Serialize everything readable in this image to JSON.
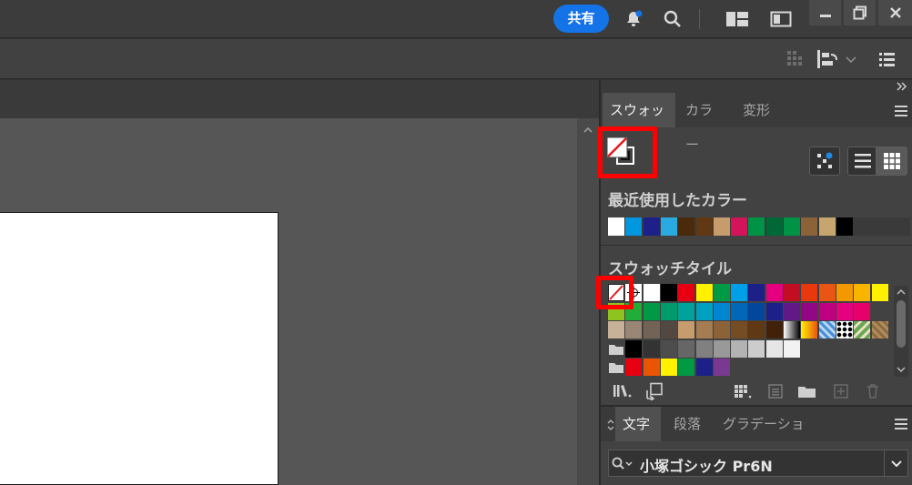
{
  "titlebar": {
    "share_label": "共有",
    "icons": [
      "bell-icon",
      "search-icon",
      "workspace-icon",
      "panel-icon",
      "minimize-icon",
      "restore-icon",
      "close-icon"
    ]
  },
  "toolbar": {
    "icons": [
      "grid-dots-icon",
      "align-icon",
      "chevron-down-icon",
      "list-icon"
    ]
  },
  "swatch_panel": {
    "tabs": [
      "スウォッチ",
      "カラー",
      "変形"
    ],
    "active_tab": "スウォッチ",
    "recent_label": "最近使用したカラー",
    "recent_colors": [
      "#ffffff",
      "#0096e0",
      "#1d2088",
      "#29abe2",
      "#4a2a0a",
      "#603813",
      "#c69c6d",
      "#d4145a",
      "#009245",
      "#006837",
      "#009245",
      "#8c6239",
      "#c7a56e",
      "#000000"
    ],
    "tiles_label": "スウォッチタイル",
    "tile_rows": [
      [
        "none",
        "registration",
        "#ffffff",
        "#000000",
        "#e60012",
        "#fff100",
        "#009944",
        "#00a0e9",
        "#1d2088",
        "#e4007f",
        "#c30d23",
        "#e8380d",
        "#e95513",
        "#f39800",
        "#f8b500",
        "#fff100"
      ],
      [
        "#8fc31f",
        "#22ac38",
        "#009944",
        "#009b6b",
        "#00a29a",
        "#00a0c1",
        "#0086d1",
        "#0068b7",
        "#00479d",
        "#1d2088",
        "#601986",
        "#920783",
        "#be0081",
        "#e4007f",
        "#e5006a"
      ],
      [
        "#c7b299",
        "#998675",
        "#736357",
        "#534741",
        "#c69c6d",
        "#a67c52",
        "#8c6239",
        "#754c24",
        "#603813",
        "#42210b",
        "gradient-bw",
        "gradient-yellow",
        "pattern-blue",
        "pattern-dots",
        "pattern-leaf",
        "pattern-tan"
      ],
      [
        "folder",
        "#000000",
        "#333333",
        "#4d4d4d",
        "#666666",
        "#808080",
        "#999999",
        "#b3b3b3",
        "#cccccc",
        "#e6e6e6",
        "#f2f2f2"
      ],
      [
        "folder",
        "#e60012",
        "#ea5504",
        "#fff100",
        "#009944",
        "#1d2088",
        "#7a3990"
      ]
    ],
    "bottom_icons": [
      "library-icon",
      "import-icon",
      "grid-menu-icon",
      "swatch-options-icon",
      "new-folder-icon",
      "new-swatch-icon",
      "delete-icon"
    ]
  },
  "text_panel": {
    "tabs": [
      "文字",
      "段落",
      "グラデーション"
    ],
    "active_tab": "文字",
    "font_name": "小塚ゴシック Pr6N"
  },
  "highlight_color": "#ff0000"
}
